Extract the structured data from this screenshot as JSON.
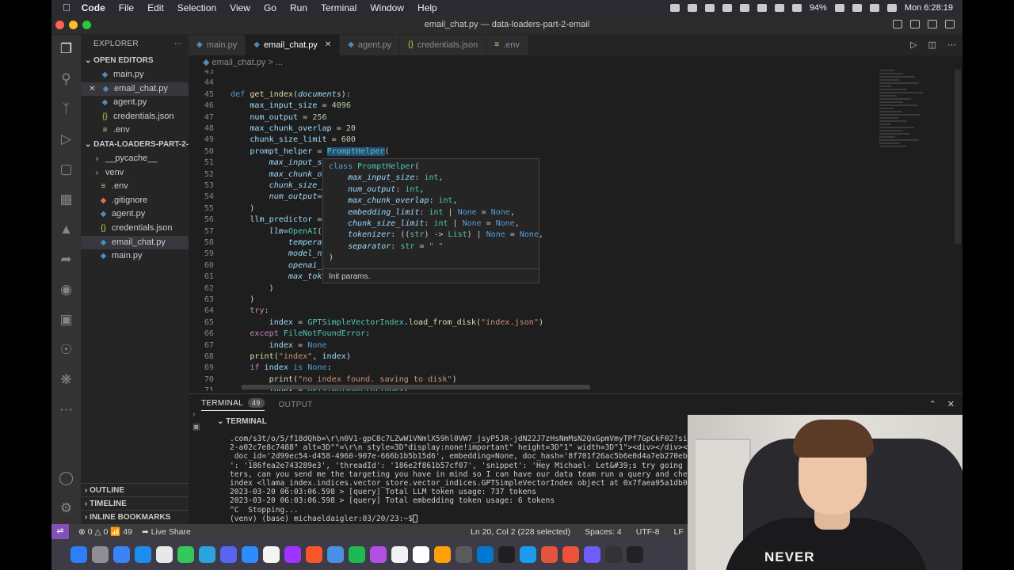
{
  "menubar": {
    "app": "Code",
    "items": [
      "File",
      "Edit",
      "Selection",
      "View",
      "Go",
      "Run",
      "Terminal",
      "Window",
      "Help"
    ],
    "battery": "94%",
    "date": "Mon 6:28:19"
  },
  "window": {
    "title": "email_chat.py — data-loaders-part-2-email"
  },
  "explorer": {
    "header": "EXPLORER",
    "open_editors_label": "OPEN EDITORS",
    "open_editors": [
      {
        "name": "main.py",
        "icon": "python-icon"
      },
      {
        "name": "email_chat.py",
        "icon": "python-icon"
      },
      {
        "name": "agent.py",
        "icon": "python-icon"
      },
      {
        "name": "credentials.json",
        "icon": "json-icon"
      },
      {
        "name": ".env",
        "icon": "env-icon"
      }
    ],
    "folder_label": "DATA-LOADERS-PART-2-...",
    "files": [
      {
        "name": "__pycache__",
        "kind": "folder"
      },
      {
        "name": "venv",
        "kind": "folder"
      },
      {
        "name": ".env",
        "kind": "file"
      },
      {
        "name": ".gitignore",
        "kind": "file"
      },
      {
        "name": "agent.py",
        "kind": "file"
      },
      {
        "name": "credentials.json",
        "kind": "file"
      },
      {
        "name": "email_chat.py",
        "kind": "file"
      },
      {
        "name": "main.py",
        "kind": "file"
      }
    ],
    "outline": "OUTLINE",
    "timeline": "TIMELINE",
    "bookmarks": "INLINE BOOKMARKS"
  },
  "tabs": [
    {
      "label": "main.py",
      "active": false
    },
    {
      "label": "email_chat.py",
      "active": true
    },
    {
      "label": "agent.py",
      "active": false
    },
    {
      "label": "credentials.json",
      "active": false
    },
    {
      "label": ".env",
      "active": false
    }
  ],
  "breadcrumb": {
    "file": "email_chat.py",
    "rest": "> ..."
  },
  "code": {
    "line_numbers": [
      "43",
      "44",
      "45",
      "46",
      "47",
      "48",
      "49",
      "50",
      "51",
      "52",
      "53",
      "54",
      "55",
      "56",
      "57",
      "58",
      "59",
      "60",
      "61",
      "62",
      "63",
      "64",
      "65",
      "66",
      "67",
      "68",
      "69",
      "70",
      "71"
    ],
    "lines": [
      "",
      "",
      "def get_index(documents):",
      "    max_input_size = 4096",
      "    num_output = 256",
      "    max_chunk_overlap = 20",
      "    chunk_size_limit = 600",
      "    prompt_helper = PromptHelper(",
      "        max_input_si",
      "        max_chunk_ov",
      "        chunk_size_l",
      "        num_output=n",
      "    )",
      "    llm_predictor = ",
      "        llm=OpenAI(",
      "            temperat",
      "            model_na",
      "            openai_a",
      "            max_toke",
      "        )",
      "    )",
      "    try:",
      "        index = GPTSimpleVectorIndex.load_from_disk(\"index.json\")",
      "    except FileNotFoundError:",
      "        index = None",
      "    print(\"index\", index)",
      "    if index is None:",
      "        print(\"no index found. saving to disk\")",
      "        index = GPTSimpleVectorIndex("
    ]
  },
  "hover": {
    "signature": [
      "class PromptHelper(",
      "    max_input_size: int,",
      "    num_output: int,",
      "    max_chunk_overlap: int,",
      "    embedding_limit: int | None = None,",
      "    chunk_size_limit: int | None = None,",
      "    tokenizer: ((str) -> List) | None = None,",
      "    separator: str = \" \"",
      ")"
    ],
    "doc": "Init params."
  },
  "panel": {
    "terminal_tab": "TERMINAL",
    "terminal_count": "49",
    "output_tab": "OUTPUT",
    "terminal_header": "TERMINAL",
    "lines": [
      ".com/s3t/o/5/f18dQhb=\\r\\n0V1-gpC8c7LZwW1VNmlX59hl0VW7_jsyP5JR-jdN22J7zHsNmMsN2QxGpmVmyTPf7GpCkF02?si=\\r",
      "2-a02c7e8c7488\" alt=3D\"\"=\\r\\n style=3D\"display:none!important\" height=3D\"1\" width=3D\"1\"><div></div></d",
      " doc_id='2d99ec54-d458-4960-907e-666b1b5b15d6', embedding=None, doc_hash='8f701f26ac5b6e0d4a7eb270ebbef",
      "': '186fea2e743289e3', 'threadId': '186e2f861b57cf07', 'snippet': 'Hey Michael- Let&#39;s try going ove",
      "ters, can you send me the targeting you have in mind so I can have our data team run a query and check",
      "index <llama_index.indices.vector_store.vector_indices.GPTSimpleVectorIndex object at 0x7faea95a1db0>",
      "2023-03-20 06:03:06.598 > [query] Total LLM token usage: 737 tokens",
      "2023-03-20 06:03:06.598 > [query] Total embedding token usage: 6 tokens",
      "^C  Stopping...",
      "(venv) (base) michaeldaigler:03/20/23:~$"
    ]
  },
  "status": {
    "problems": "0",
    "warnings": "0",
    "ports": "49",
    "live_share": "Live Share",
    "position": "Ln 20, Col 2 (228 selected)",
    "spaces": "Spaces: 4",
    "encoding": "UTF-8",
    "eol": "LF"
  },
  "webcam": {
    "shirt_text": "NEVER"
  }
}
